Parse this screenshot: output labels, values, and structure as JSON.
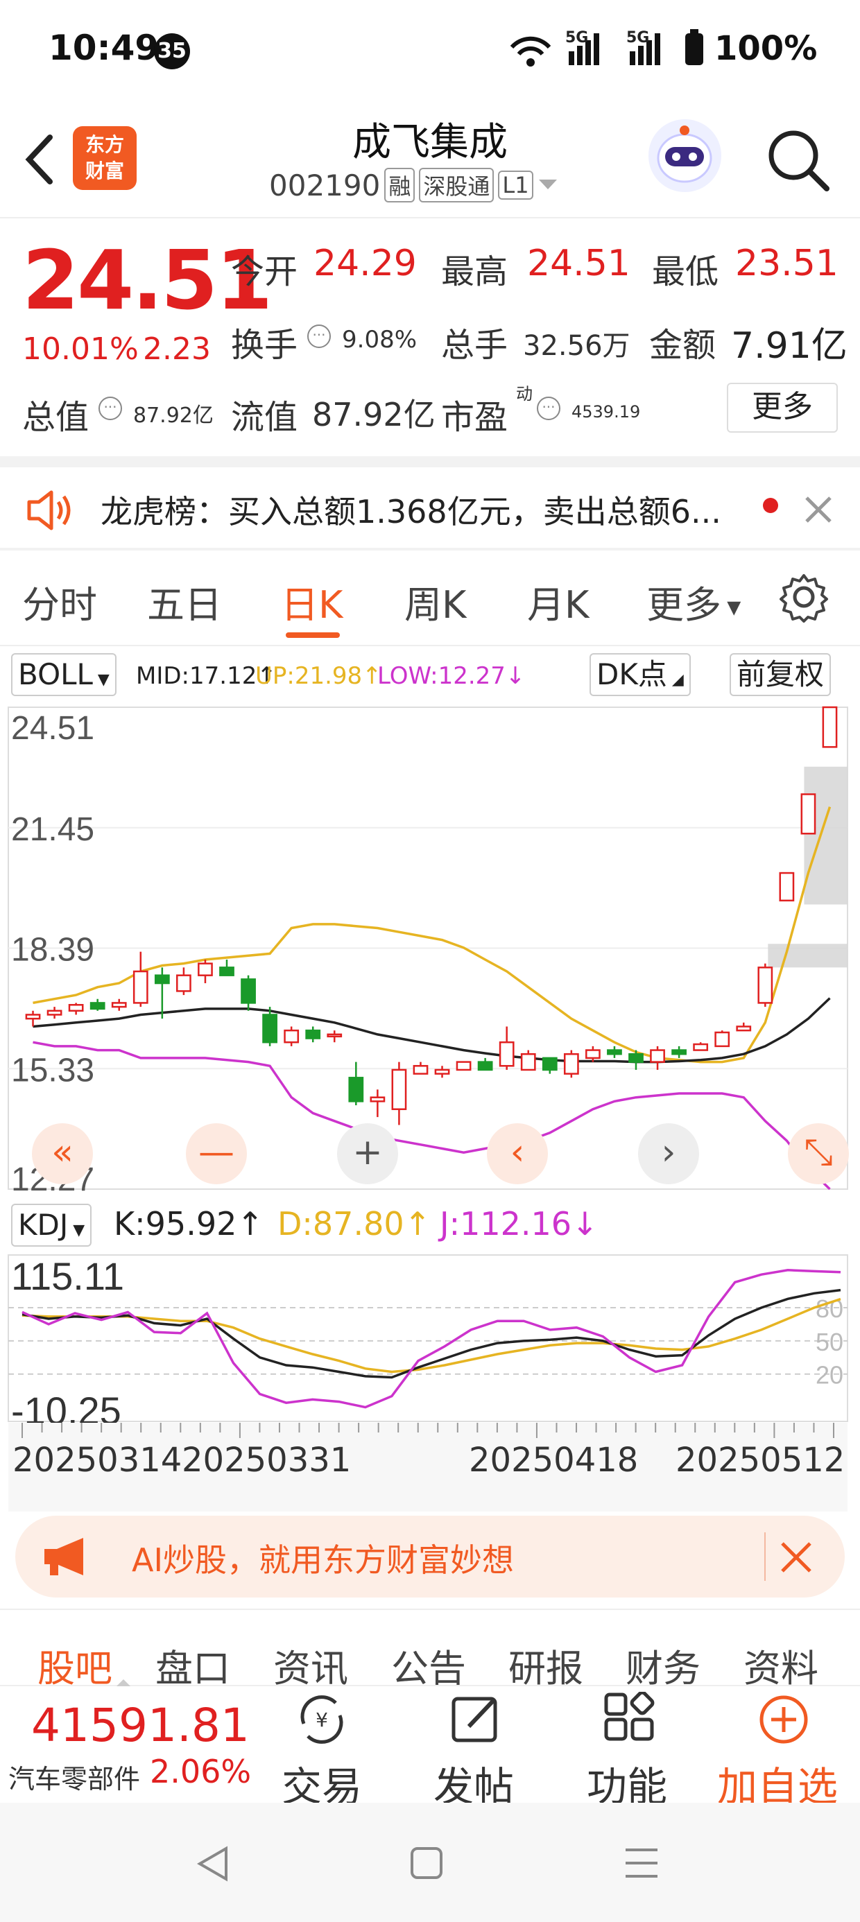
{
  "status_bar": {
    "time": "10:49",
    "notification_count": "35",
    "network_1": "5G",
    "network_2": "5G",
    "battery": "100%"
  },
  "header": {
    "logo_line1": "东方",
    "logo_line2": "财富",
    "stock_name": "成飞集成",
    "stock_code": "002190",
    "tags": [
      "融",
      "深股通",
      "L1"
    ]
  },
  "quote": {
    "price": "24.51",
    "change_pct": "10.01%",
    "change_amt": "2.23",
    "open_label": "今开",
    "open": "24.29",
    "high_label": "最高",
    "high": "24.51",
    "low_label": "最低",
    "low": "23.51",
    "turnover_label": "换手",
    "turnover": "9.08%",
    "volume_label": "总手",
    "volume": "32.56万",
    "amount_label": "金额",
    "amount": "7.91亿",
    "mktcap_label": "总值",
    "mktcap": "87.92亿",
    "float_label": "流值",
    "float_cap": "87.92亿",
    "pe_label": "市盈",
    "pe_sup": "动",
    "pe": "4539.19",
    "more": "更多"
  },
  "notice": {
    "text": "龙虎榜：买入总额1.368亿元，卖出总额6..."
  },
  "period_tabs": [
    "分时",
    "五日",
    "日K",
    "周K",
    "月K",
    "更多"
  ],
  "active_period": "日K",
  "indicator": {
    "name": "BOLL",
    "mid": "MID:17.12↑",
    "up": "UP:21.98↑",
    "low": "LOW:12.27↓",
    "dk": "DK点",
    "adjust": "前复权"
  },
  "kdj": {
    "name": "KDJ",
    "k": "K:95.92↑",
    "d": "D:87.80↑",
    "j": "J:112.16↓"
  },
  "chart_data": [
    {
      "type": "candlestick",
      "title": "",
      "y_ticks": [
        "24.51",
        "21.45",
        "18.39",
        "15.33",
        "12.27"
      ],
      "ylim": [
        12.27,
        24.51
      ],
      "ohlc": [
        [
          16.6,
          16.8,
          16.4,
          16.7
        ],
        [
          16.7,
          16.9,
          16.6,
          16.8
        ],
        [
          16.8,
          17.0,
          16.7,
          16.95
        ],
        [
          17.0,
          17.1,
          16.8,
          16.85
        ],
        [
          16.9,
          17.1,
          16.8,
          17.0
        ],
        [
          17.0,
          18.3,
          16.9,
          17.8
        ],
        [
          17.7,
          17.9,
          16.6,
          17.5
        ],
        [
          17.3,
          17.9,
          17.2,
          17.7
        ],
        [
          17.7,
          18.1,
          17.5,
          18.0
        ],
        [
          17.9,
          18.1,
          17.7,
          17.7
        ],
        [
          17.6,
          17.7,
          16.8,
          17.0
        ],
        [
          16.7,
          16.9,
          15.9,
          16.0
        ],
        [
          16.0,
          16.4,
          15.9,
          16.3
        ],
        [
          16.3,
          16.4,
          16.0,
          16.1
        ],
        [
          16.2,
          16.3,
          16.0,
          16.2
        ],
        [
          15.1,
          15.5,
          14.4,
          14.5
        ],
        [
          14.5,
          14.8,
          14.1,
          14.6
        ],
        [
          14.3,
          15.5,
          13.9,
          15.3
        ],
        [
          15.2,
          15.5,
          15.2,
          15.4
        ],
        [
          15.2,
          15.4,
          15.1,
          15.3
        ],
        [
          15.3,
          15.5,
          15.3,
          15.5
        ],
        [
          15.5,
          15.6,
          15.3,
          15.3
        ],
        [
          15.4,
          16.4,
          15.3,
          16.0
        ],
        [
          15.3,
          15.8,
          15.3,
          15.7
        ],
        [
          15.6,
          15.6,
          15.2,
          15.3
        ],
        [
          15.2,
          15.8,
          15.1,
          15.7
        ],
        [
          15.6,
          15.9,
          15.5,
          15.8
        ],
        [
          15.8,
          15.9,
          15.6,
          15.7
        ],
        [
          15.7,
          15.8,
          15.3,
          15.5
        ],
        [
          15.5,
          15.9,
          15.3,
          15.8
        ],
        [
          15.8,
          15.9,
          15.6,
          15.7
        ],
        [
          15.8,
          16.0,
          15.8,
          15.95
        ],
        [
          15.9,
          16.3,
          15.9,
          16.25
        ],
        [
          16.3,
          16.5,
          16.3,
          16.4
        ],
        [
          17.0,
          18.0,
          16.9,
          17.9
        ],
        [
          19.6,
          20.3,
          19.6,
          20.3
        ],
        [
          21.3,
          22.3,
          21.3,
          22.3
        ],
        [
          23.5,
          24.51,
          23.5,
          24.51
        ]
      ],
      "mid": [
        16.4,
        16.45,
        16.5,
        16.55,
        16.6,
        16.7,
        16.75,
        16.8,
        16.85,
        16.85,
        16.85,
        16.8,
        16.7,
        16.6,
        16.5,
        16.35,
        16.2,
        16.1,
        16.0,
        15.9,
        15.8,
        15.72,
        15.65,
        15.6,
        15.55,
        15.52,
        15.52,
        15.52,
        15.5,
        15.5,
        15.52,
        15.55,
        15.6,
        15.7,
        15.9,
        16.2,
        16.6,
        17.12
      ],
      "up": [
        17.0,
        17.1,
        17.2,
        17.4,
        17.5,
        17.8,
        17.95,
        18.0,
        18.1,
        18.15,
        18.2,
        18.25,
        18.9,
        19.0,
        19.0,
        18.95,
        18.9,
        18.8,
        18.7,
        18.6,
        18.4,
        18.1,
        17.8,
        17.4,
        17.0,
        16.6,
        16.3,
        16.0,
        15.75,
        15.6,
        15.55,
        15.5,
        15.5,
        15.6,
        16.5,
        18.3,
        20.3,
        21.98
      ],
      "low": [
        16.0,
        15.9,
        15.9,
        15.8,
        15.8,
        15.6,
        15.6,
        15.6,
        15.6,
        15.55,
        15.5,
        15.4,
        14.6,
        14.2,
        14.0,
        13.8,
        13.6,
        13.5,
        13.4,
        13.3,
        13.2,
        13.3,
        13.4,
        13.5,
        13.7,
        14.0,
        14.3,
        14.5,
        14.6,
        14.65,
        14.7,
        14.7,
        14.7,
        14.6,
        14.0,
        13.5,
        12.8,
        12.27
      ]
    },
    {
      "type": "line",
      "title": "",
      "y_ticks": [
        "115.11",
        "-10.25"
      ],
      "ref_levels": [
        "80",
        "50",
        "20"
      ],
      "ylim": [
        -10.25,
        115.11
      ],
      "x_labels": [
        "20250314",
        "20250331",
        "20250418",
        "20250512"
      ],
      "series": [
        {
          "name": "K",
          "values": [
            74,
            70,
            72,
            71,
            73,
            66,
            64,
            70,
            52,
            35,
            28,
            26,
            22,
            18,
            17,
            26,
            34,
            42,
            48,
            50,
            51,
            53,
            50,
            42,
            36,
            37,
            55,
            70,
            80,
            88,
            93,
            95.92
          ]
        },
        {
          "name": "D",
          "values": [
            73,
            72,
            72,
            72,
            72,
            70,
            68,
            68,
            62,
            52,
            45,
            38,
            32,
            25,
            22,
            24,
            28,
            33,
            38,
            42,
            46,
            48,
            48,
            46,
            43,
            42,
            45,
            52,
            60,
            70,
            80,
            87.8
          ]
        },
        {
          "name": "J",
          "values": [
            76,
            65,
            75,
            69,
            76,
            58,
            57,
            75,
            30,
            2,
            -6,
            -3,
            -5,
            -10,
            0,
            32,
            45,
            60,
            68,
            68,
            60,
            62,
            54,
            35,
            22,
            28,
            72,
            103,
            110,
            114,
            113,
            112.16
          ]
        }
      ]
    }
  ],
  "ai_banner": {
    "text": "AI炒股，就用东方财富妙想"
  },
  "bottom_tabs": [
    "股吧",
    "盘口",
    "资讯",
    "公告",
    "研报",
    "财务",
    "资料"
  ],
  "toolbar": {
    "index_value": "41591.81",
    "index_name": "汽车零部件",
    "index_pct": "2.06%",
    "trade": "交易",
    "post": "发帖",
    "func": "功能",
    "add": "加自选"
  },
  "colors": {
    "accent": "#f15a22",
    "up": "#e02020",
    "down": "#1a9a2a",
    "mid": "#222222",
    "boll_up": "#e6b422",
    "boll_low": "#cc33cc"
  }
}
